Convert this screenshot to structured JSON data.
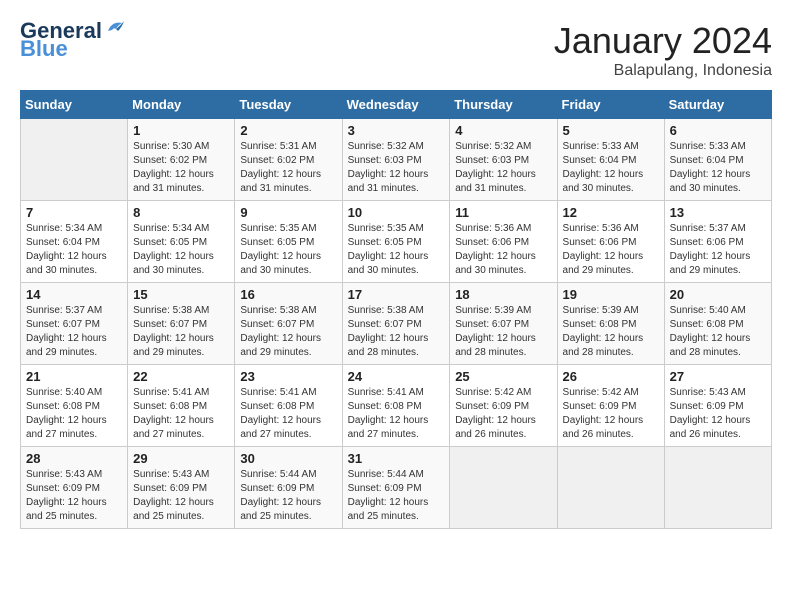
{
  "logo": {
    "line1": "General",
    "line2": "Blue"
  },
  "title": "January 2024",
  "location": "Balapulang, Indonesia",
  "weekdays": [
    "Sunday",
    "Monday",
    "Tuesday",
    "Wednesday",
    "Thursday",
    "Friday",
    "Saturday"
  ],
  "weeks": [
    [
      {
        "day": "",
        "sunrise": "",
        "sunset": "",
        "daylight": ""
      },
      {
        "day": "1",
        "sunrise": "Sunrise: 5:30 AM",
        "sunset": "Sunset: 6:02 PM",
        "daylight": "Daylight: 12 hours and 31 minutes."
      },
      {
        "day": "2",
        "sunrise": "Sunrise: 5:31 AM",
        "sunset": "Sunset: 6:02 PM",
        "daylight": "Daylight: 12 hours and 31 minutes."
      },
      {
        "day": "3",
        "sunrise": "Sunrise: 5:32 AM",
        "sunset": "Sunset: 6:03 PM",
        "daylight": "Daylight: 12 hours and 31 minutes."
      },
      {
        "day": "4",
        "sunrise": "Sunrise: 5:32 AM",
        "sunset": "Sunset: 6:03 PM",
        "daylight": "Daylight: 12 hours and 31 minutes."
      },
      {
        "day": "5",
        "sunrise": "Sunrise: 5:33 AM",
        "sunset": "Sunset: 6:04 PM",
        "daylight": "Daylight: 12 hours and 30 minutes."
      },
      {
        "day": "6",
        "sunrise": "Sunrise: 5:33 AM",
        "sunset": "Sunset: 6:04 PM",
        "daylight": "Daylight: 12 hours and 30 minutes."
      }
    ],
    [
      {
        "day": "7",
        "sunrise": "Sunrise: 5:34 AM",
        "sunset": "Sunset: 6:04 PM",
        "daylight": "Daylight: 12 hours and 30 minutes."
      },
      {
        "day": "8",
        "sunrise": "Sunrise: 5:34 AM",
        "sunset": "Sunset: 6:05 PM",
        "daylight": "Daylight: 12 hours and 30 minutes."
      },
      {
        "day": "9",
        "sunrise": "Sunrise: 5:35 AM",
        "sunset": "Sunset: 6:05 PM",
        "daylight": "Daylight: 12 hours and 30 minutes."
      },
      {
        "day": "10",
        "sunrise": "Sunrise: 5:35 AM",
        "sunset": "Sunset: 6:05 PM",
        "daylight": "Daylight: 12 hours and 30 minutes."
      },
      {
        "day": "11",
        "sunrise": "Sunrise: 5:36 AM",
        "sunset": "Sunset: 6:06 PM",
        "daylight": "Daylight: 12 hours and 30 minutes."
      },
      {
        "day": "12",
        "sunrise": "Sunrise: 5:36 AM",
        "sunset": "Sunset: 6:06 PM",
        "daylight": "Daylight: 12 hours and 29 minutes."
      },
      {
        "day": "13",
        "sunrise": "Sunrise: 5:37 AM",
        "sunset": "Sunset: 6:06 PM",
        "daylight": "Daylight: 12 hours and 29 minutes."
      }
    ],
    [
      {
        "day": "14",
        "sunrise": "Sunrise: 5:37 AM",
        "sunset": "Sunset: 6:07 PM",
        "daylight": "Daylight: 12 hours and 29 minutes."
      },
      {
        "day": "15",
        "sunrise": "Sunrise: 5:38 AM",
        "sunset": "Sunset: 6:07 PM",
        "daylight": "Daylight: 12 hours and 29 minutes."
      },
      {
        "day": "16",
        "sunrise": "Sunrise: 5:38 AM",
        "sunset": "Sunset: 6:07 PM",
        "daylight": "Daylight: 12 hours and 29 minutes."
      },
      {
        "day": "17",
        "sunrise": "Sunrise: 5:38 AM",
        "sunset": "Sunset: 6:07 PM",
        "daylight": "Daylight: 12 hours and 28 minutes."
      },
      {
        "day": "18",
        "sunrise": "Sunrise: 5:39 AM",
        "sunset": "Sunset: 6:07 PM",
        "daylight": "Daylight: 12 hours and 28 minutes."
      },
      {
        "day": "19",
        "sunrise": "Sunrise: 5:39 AM",
        "sunset": "Sunset: 6:08 PM",
        "daylight": "Daylight: 12 hours and 28 minutes."
      },
      {
        "day": "20",
        "sunrise": "Sunrise: 5:40 AM",
        "sunset": "Sunset: 6:08 PM",
        "daylight": "Daylight: 12 hours and 28 minutes."
      }
    ],
    [
      {
        "day": "21",
        "sunrise": "Sunrise: 5:40 AM",
        "sunset": "Sunset: 6:08 PM",
        "daylight": "Daylight: 12 hours and 27 minutes."
      },
      {
        "day": "22",
        "sunrise": "Sunrise: 5:41 AM",
        "sunset": "Sunset: 6:08 PM",
        "daylight": "Daylight: 12 hours and 27 minutes."
      },
      {
        "day": "23",
        "sunrise": "Sunrise: 5:41 AM",
        "sunset": "Sunset: 6:08 PM",
        "daylight": "Daylight: 12 hours and 27 minutes."
      },
      {
        "day": "24",
        "sunrise": "Sunrise: 5:41 AM",
        "sunset": "Sunset: 6:08 PM",
        "daylight": "Daylight: 12 hours and 27 minutes."
      },
      {
        "day": "25",
        "sunrise": "Sunrise: 5:42 AM",
        "sunset": "Sunset: 6:09 PM",
        "daylight": "Daylight: 12 hours and 26 minutes."
      },
      {
        "day": "26",
        "sunrise": "Sunrise: 5:42 AM",
        "sunset": "Sunset: 6:09 PM",
        "daylight": "Daylight: 12 hours and 26 minutes."
      },
      {
        "day": "27",
        "sunrise": "Sunrise: 5:43 AM",
        "sunset": "Sunset: 6:09 PM",
        "daylight": "Daylight: 12 hours and 26 minutes."
      }
    ],
    [
      {
        "day": "28",
        "sunrise": "Sunrise: 5:43 AM",
        "sunset": "Sunset: 6:09 PM",
        "daylight": "Daylight: 12 hours and 25 minutes."
      },
      {
        "day": "29",
        "sunrise": "Sunrise: 5:43 AM",
        "sunset": "Sunset: 6:09 PM",
        "daylight": "Daylight: 12 hours and 25 minutes."
      },
      {
        "day": "30",
        "sunrise": "Sunrise: 5:44 AM",
        "sunset": "Sunset: 6:09 PM",
        "daylight": "Daylight: 12 hours and 25 minutes."
      },
      {
        "day": "31",
        "sunrise": "Sunrise: 5:44 AM",
        "sunset": "Sunset: 6:09 PM",
        "daylight": "Daylight: 12 hours and 25 minutes."
      },
      {
        "day": "",
        "sunrise": "",
        "sunset": "",
        "daylight": ""
      },
      {
        "day": "",
        "sunrise": "",
        "sunset": "",
        "daylight": ""
      },
      {
        "day": "",
        "sunrise": "",
        "sunset": "",
        "daylight": ""
      }
    ]
  ]
}
